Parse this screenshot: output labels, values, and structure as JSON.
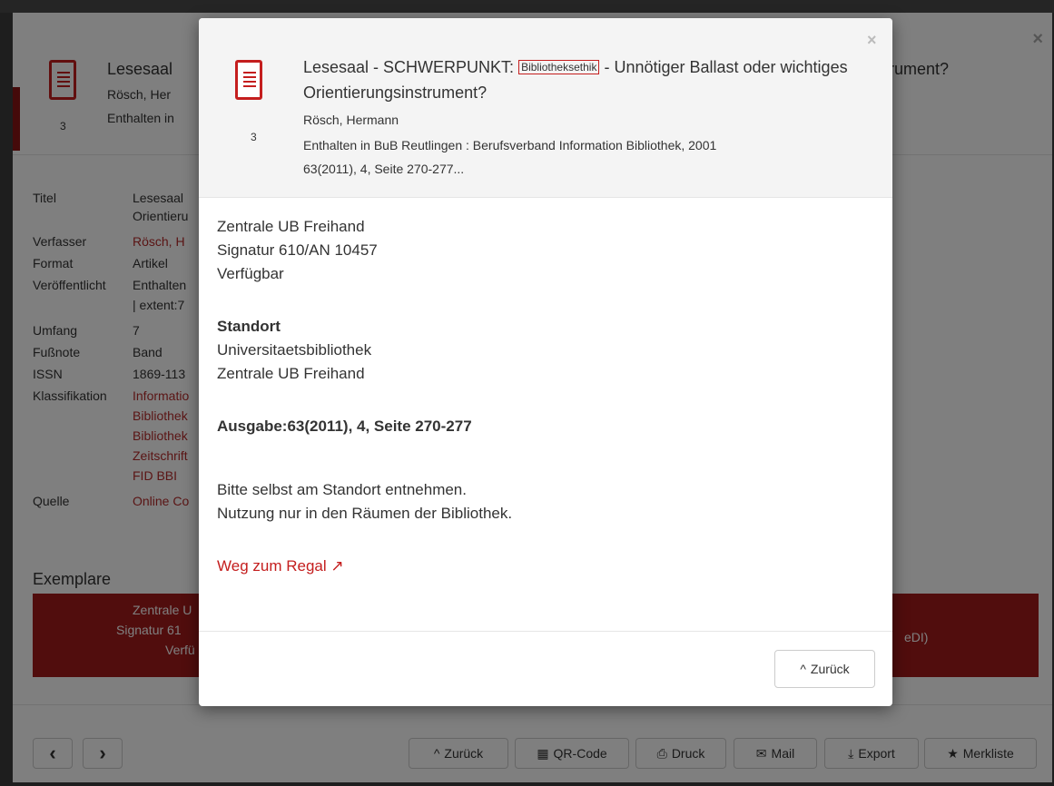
{
  "background": {
    "header": {
      "title": "Lesesaal",
      "title_right": "rument?",
      "author": "Rösch, Her",
      "contains": "Enthalten in",
      "count": "3"
    },
    "details": [
      {
        "label": "Titel",
        "value": "Lesesaal",
        "value2": "Orientieru",
        "red": false
      },
      {
        "label": "Verfasser",
        "value": "Rösch, H",
        "red": true
      },
      {
        "label": "Format",
        "value": "Artikel",
        "red": false
      },
      {
        "label": "Veröffentlicht",
        "value": "Enthalten",
        "value2": "| extent:7",
        "red": false
      },
      {
        "label": "Umfang",
        "value": "7",
        "red": false
      },
      {
        "label": "Fußnote",
        "value": "Band",
        "red": false
      },
      {
        "label": "ISSN",
        "value": "1869-113",
        "red": false
      },
      {
        "label": "Klassifikation",
        "value": "Informatio",
        "red": true
      },
      {
        "label": "",
        "value": "Bibliothek",
        "red": true
      },
      {
        "label": "",
        "value": "Bibliothek",
        "red": true
      },
      {
        "label": "",
        "value": "Zeitschrift",
        "red": true
      },
      {
        "label": "",
        "value": "FID BBI",
        "red": true
      },
      {
        "label": "Quelle",
        "value": "Online Co",
        "red": true
      }
    ],
    "exemplare_heading": "Exemplare",
    "exemplar": {
      "line1": "Zentrale U",
      "line2": "Signatur 61",
      "line3": "Verfü",
      "right": "eDI)"
    },
    "footer": {
      "prev_label": "‹",
      "next_label": "›",
      "back": "Zurück",
      "qr": "QR-Code",
      "print": "Druck",
      "mail": "Mail",
      "export": "Export",
      "bookmark": "Merkliste"
    }
  },
  "modal": {
    "count": "3",
    "title_before": "Lesesaal - SCHWERPUNKT: ",
    "title_tag": "Bibliotheksethik",
    "title_after": " - Unnötiger Ballast oder wichtiges Orientierungsinstrument?",
    "author": "Rösch, Hermann",
    "contains": "Enthalten in BuB Reutlingen : Berufsverband Information Bibliothek, 2001",
    "issue": "63(2011), 4, Seite 270-277...",
    "location_line1": "Zentrale UB Freihand",
    "location_line2": "Signatur 610/AN 10457",
    "availability": "Verfügbar",
    "standort_heading": "Standort",
    "standort_line1": "Universitaetsbibliothek",
    "standort_line2": "Zentrale UB Freihand",
    "ausgabe": "Ausgabe:63(2011), 4, Seite 270-277",
    "note1": "Bitte selbst am Standort entnehmen.",
    "note2": "Nutzung nur in den Räumen der Bibliothek.",
    "shelf_link": "Weg zum Regal",
    "back_button": "Zurück",
    "close": "×"
  },
  "colors": {
    "accent": "#c41e1e",
    "exemplar_bg": "#a31b1b"
  }
}
